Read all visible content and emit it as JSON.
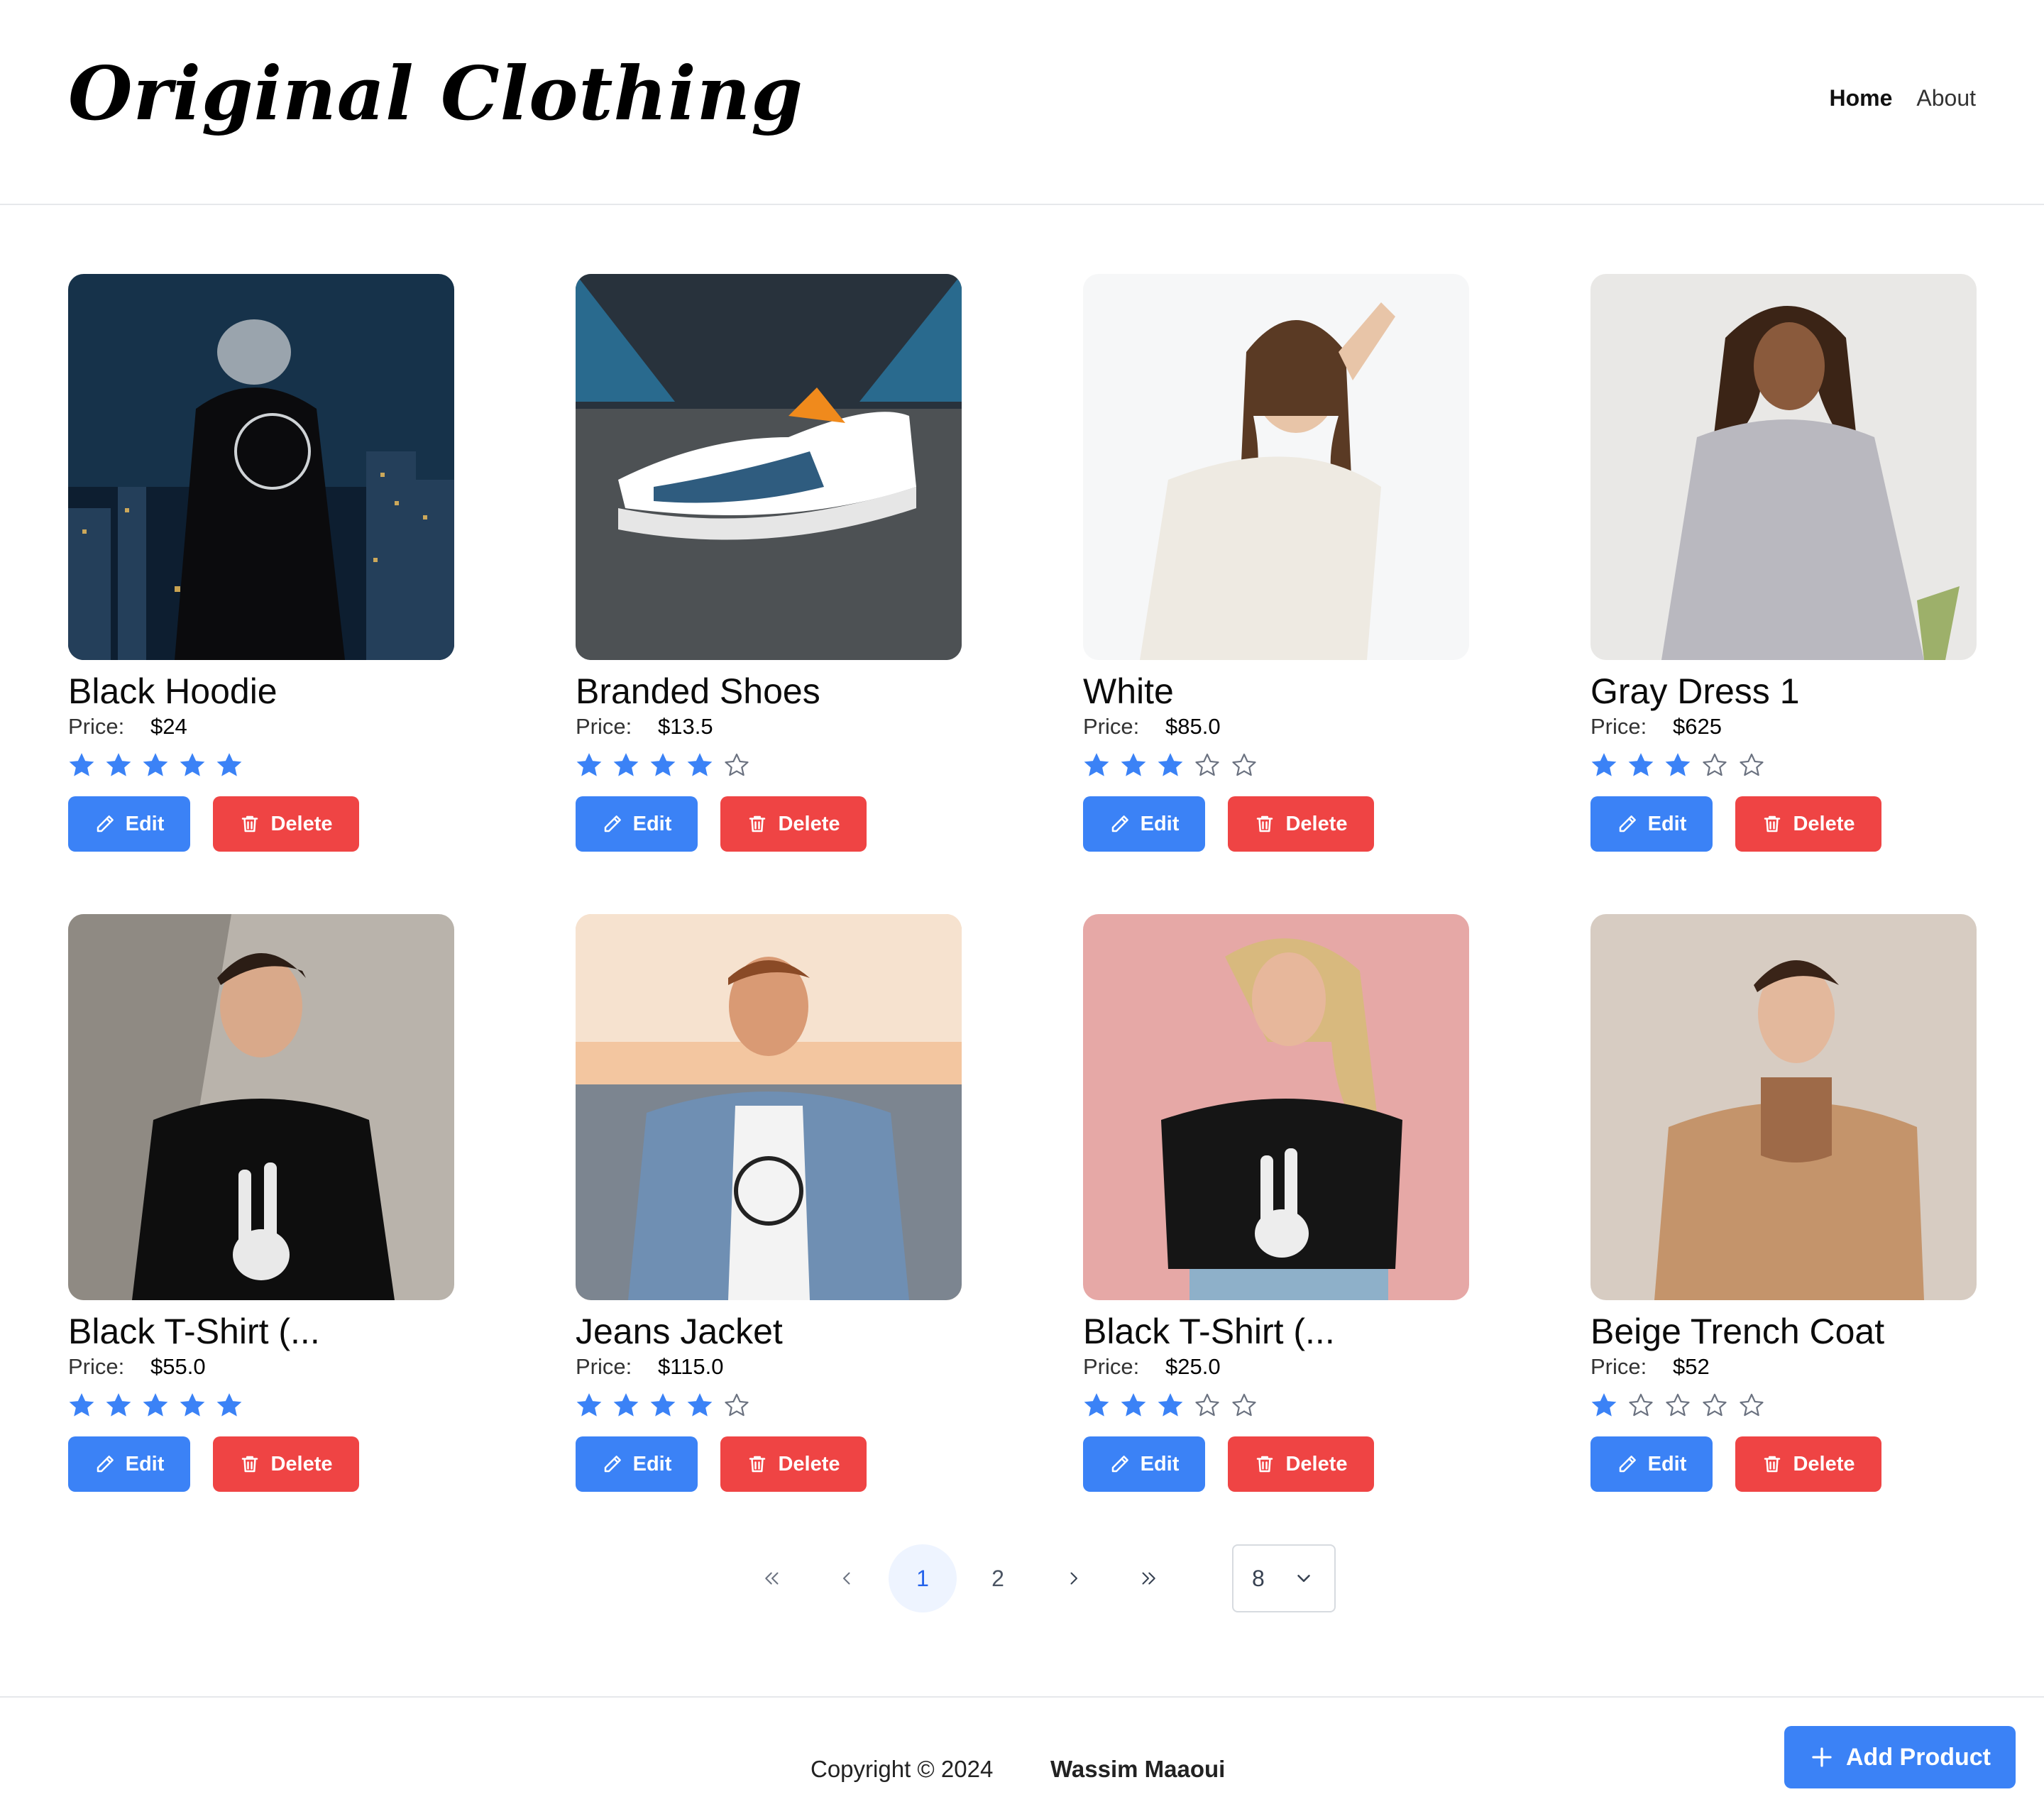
{
  "header": {
    "logo": "Original Clothing",
    "nav": [
      {
        "label": "Home",
        "active": true
      },
      {
        "label": "About",
        "active": false
      }
    ]
  },
  "products": [
    {
      "title": "Black Hoodie",
      "price_label": "Price:",
      "price": "$24",
      "rating": 5,
      "image": "man in black hoodie overlooking city at night",
      "edit_label": "Edit",
      "delete_label": "Delete"
    },
    {
      "title": "Branded Shoes",
      "price_label": "Price:",
      "price": "$13.5",
      "rating": 4,
      "image": "white, blue and orange sneaker on pavement",
      "edit_label": "Edit",
      "delete_label": "Delete"
    },
    {
      "title": "White",
      "price_label": "Price:",
      "price": "$85.0",
      "rating": 3,
      "image": "woman in white top with curly hair",
      "edit_label": "Edit",
      "delete_label": "Delete"
    },
    {
      "title": "Gray Dress 1",
      "price_label": "Price:",
      "price": "$625",
      "rating": 3,
      "image": "woman in gray dress",
      "edit_label": "Edit",
      "delete_label": "Delete"
    },
    {
      "title": "Black T-Shirt (...",
      "price_label": "Price:",
      "price": "$55.0",
      "rating": 5,
      "image": "man in black t-shirt with skeleton hand print",
      "edit_label": "Edit",
      "delete_label": "Delete"
    },
    {
      "title": "Jeans Jacket",
      "price_label": "Price:",
      "price": "$115.0",
      "rating": 4,
      "image": "man in denim jacket at sunset",
      "edit_label": "Edit",
      "delete_label": "Delete"
    },
    {
      "title": "Black T-Shirt (...",
      "price_label": "Price:",
      "price": "$25.0",
      "rating": 3,
      "image": "woman in black t-shirt against pink wall",
      "edit_label": "Edit",
      "delete_label": "Delete"
    },
    {
      "title": "Beige Trench Coat",
      "price_label": "Price:",
      "price": "$52",
      "rating": 1,
      "image": "man in beige trench coat",
      "edit_label": "Edit",
      "delete_label": "Delete"
    }
  ],
  "pagination": {
    "pages": [
      "1",
      "2"
    ],
    "current": "1",
    "rows_per_page": "8"
  },
  "footer": {
    "copyright": "Copyright © 2024",
    "author": "Wassim Maaoui",
    "add_button": "Add Product"
  },
  "colors": {
    "primary": "#3b82f6",
    "danger": "#ef4444",
    "star": "#3b82f6",
    "star_empty": "#6b7280"
  }
}
